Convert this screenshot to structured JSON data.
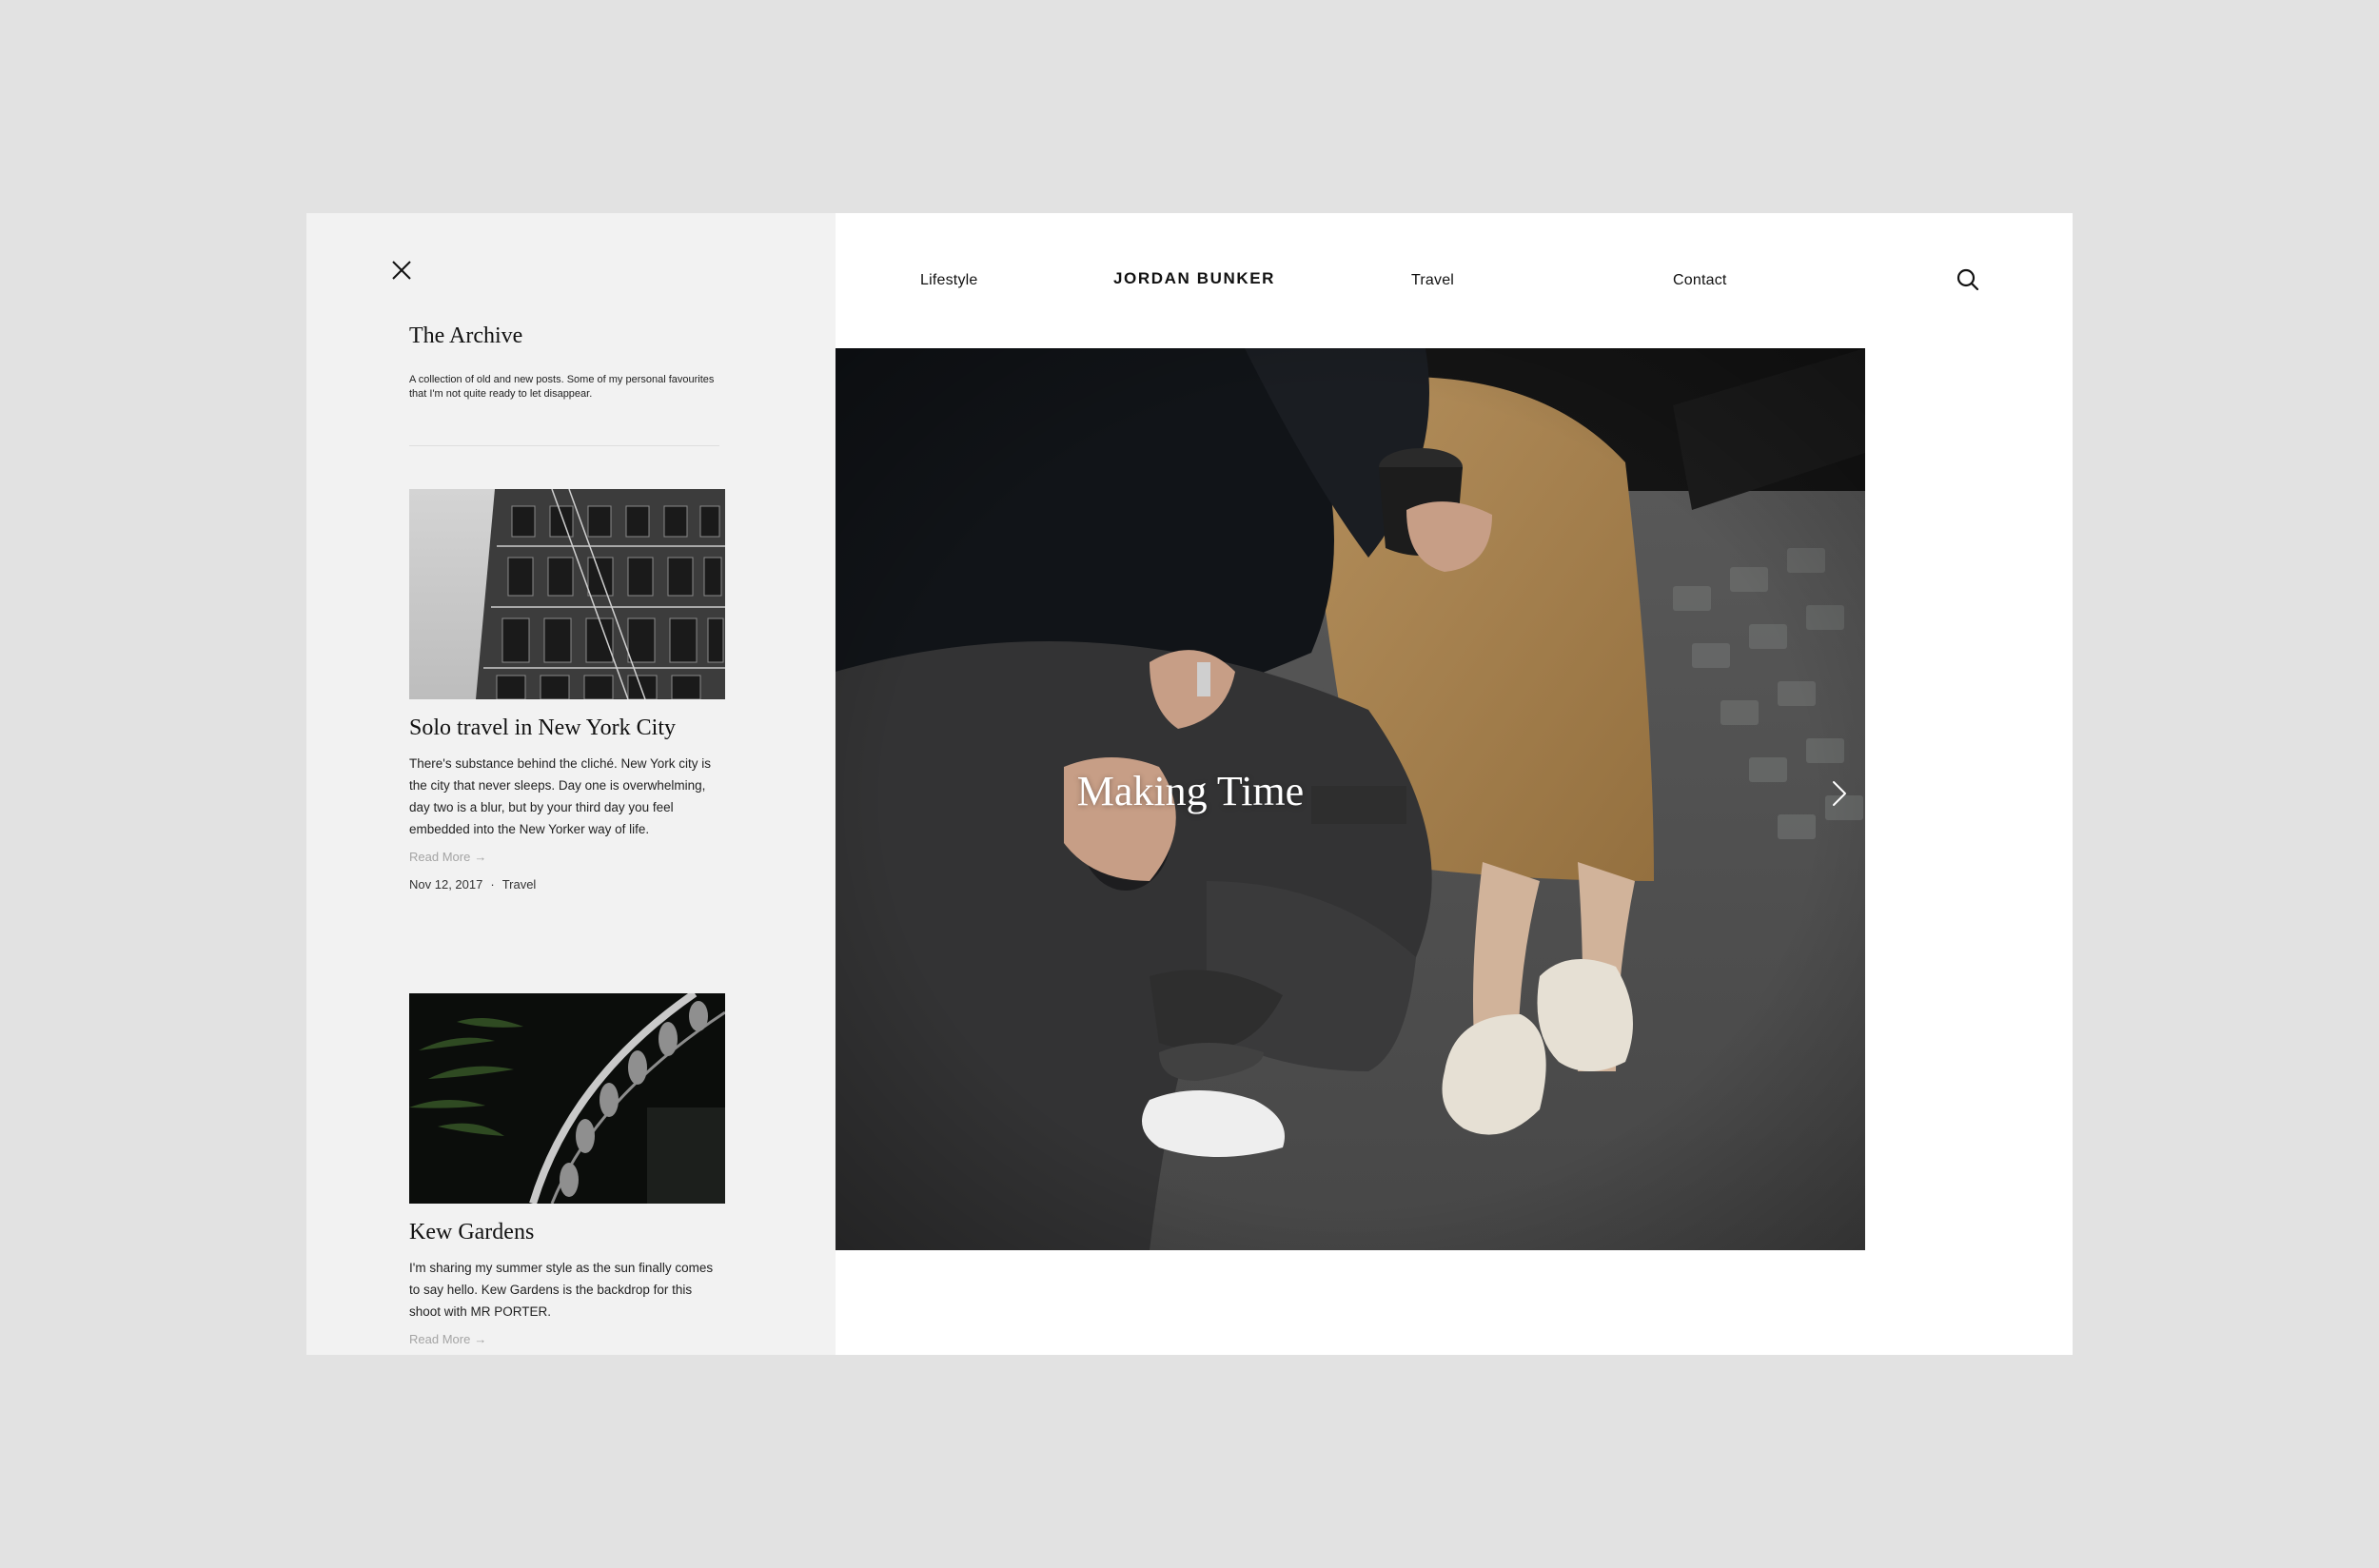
{
  "sidebar": {
    "close_icon": "close-icon",
    "archive": {
      "title": "The Archive",
      "description": "A collection of old and new posts. Some of my personal favourites that I'm not quite ready to let disappear."
    },
    "posts": [
      {
        "title": "Solo travel in New York City",
        "excerpt": "There's substance behind the cliché. New York city is the city that never sleeps. Day one is overwhelming, day two is a blur, but by your third day you feel embedded into the New Yorker way of life.",
        "read_more": "Read More",
        "date": "Nov 12, 2017",
        "meta_separator": "·",
        "category": "Travel"
      },
      {
        "title": "Kew Gardens",
        "excerpt": "I'm sharing my summer style as the sun finally comes to say hello. Kew Gardens is the backdrop for this shoot with MR PORTER.",
        "read_more": "Read More"
      }
    ]
  },
  "header": {
    "brand": "JORDAN BUNKER",
    "nav": {
      "lifestyle": "Lifestyle",
      "travel": "Travel",
      "contact": "Contact"
    },
    "search_icon": "search-icon"
  },
  "hero": {
    "title": "Making Time",
    "next_icon": "chevron-right-icon"
  },
  "colors": {
    "page_background": "#e2e2e2",
    "sidebar_background": "#f2f2f2",
    "content_background": "#ffffff",
    "read_more": "#a4a4a4",
    "text": "#111111"
  }
}
